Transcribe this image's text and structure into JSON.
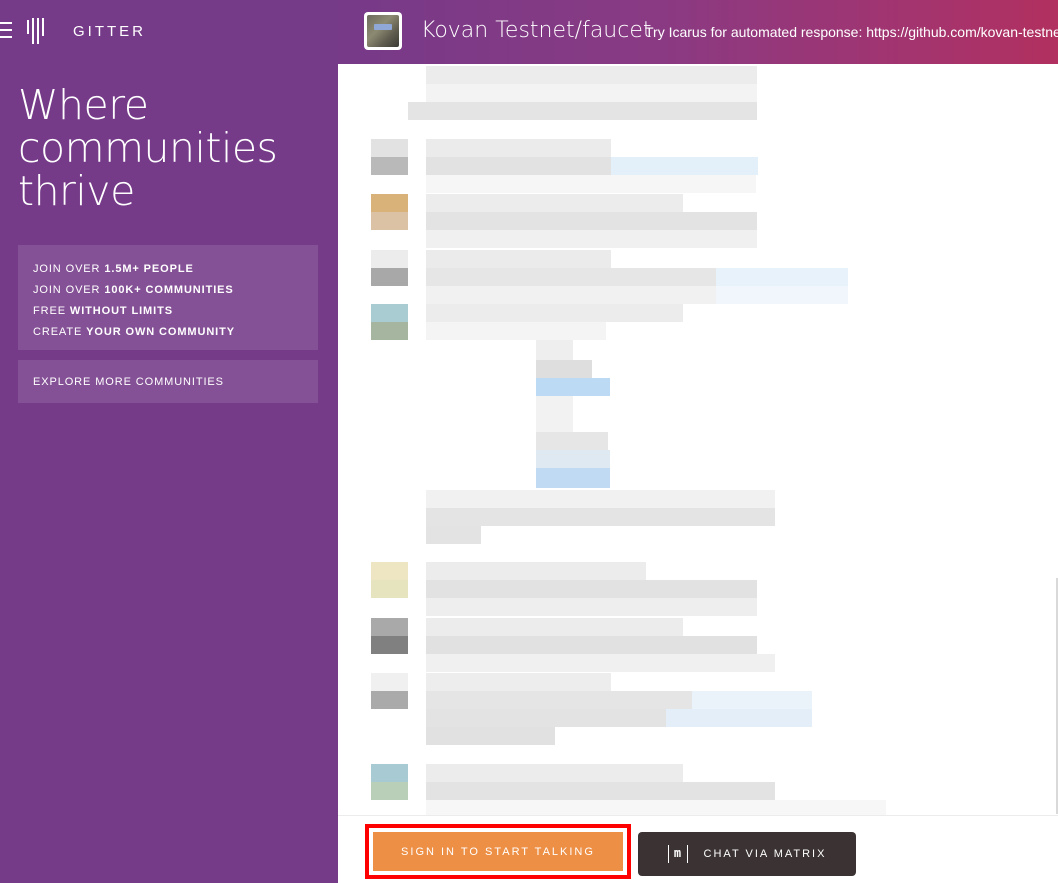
{
  "brand": {
    "name": "GITTER"
  },
  "sidebar": {
    "tagline": "Where communities thrive",
    "info_lines": [
      {
        "prefix": "JOIN OVER ",
        "bold": "1.5M+ PEOPLE"
      },
      {
        "prefix": "JOIN OVER ",
        "bold": "100K+ COMMUNITIES"
      },
      {
        "prefix": "FREE ",
        "bold": "WITHOUT LIMITS"
      },
      {
        "prefix": "CREATE ",
        "bold": "YOUR OWN COMMUNITY"
      }
    ],
    "explore_label": "EXPLORE MORE COMMUNITIES"
  },
  "header": {
    "room_title": "Kovan Testnet/faucet",
    "room_topic": "Try Icarus for automated response: https://github.com/kovan-testnet/icarus"
  },
  "footer": {
    "signin_label": "SIGN IN TO START TALKING",
    "matrix_label": "CHAT VIA MATRIX",
    "matrix_icon_text": "m"
  },
  "icons": [
    "hamburger-icon",
    "gitter-logo-icon",
    "matrix-icon"
  ],
  "colors": {
    "sidebar_bg": "#753a88",
    "header_gradient_end": "#b1305f",
    "signin_bg": "#ed8f45",
    "matrix_bg": "#3a3233",
    "highlight_border": "#ff0000"
  }
}
